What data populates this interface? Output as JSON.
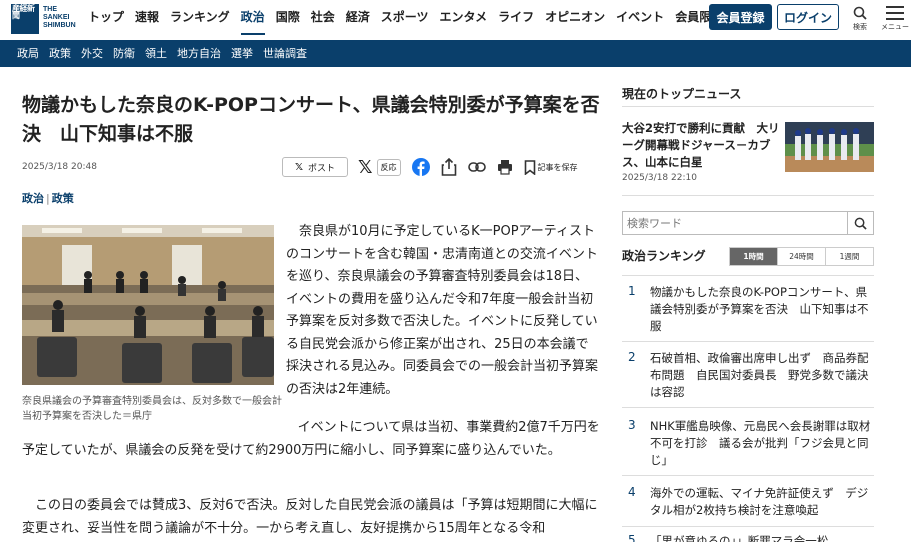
{
  "header": {
    "logo_kanji": "産経新聞",
    "logo_text": "THE\nSANKEI\nSHIMBUN",
    "nav": [
      "トップ",
      "速報",
      "ランキング",
      "政治",
      "国際",
      "社会",
      "経済",
      "スポーツ",
      "エンタメ",
      "ライフ",
      "オピニオン",
      "イベント",
      "会員限定記事"
    ],
    "active_nav": "政治",
    "register_label": "会員登録",
    "login_label": "ログイン",
    "search_label": "検索",
    "menu_label": "メニュー"
  },
  "subnav": [
    "政局",
    "政策",
    "外交",
    "防衛",
    "領土",
    "地方自治",
    "選挙",
    "世論調査"
  ],
  "article": {
    "title": "物議かもした奈良のK-POPコンサート、県議会特別委が予算案を否決　山下知事は不服",
    "date": "2025/3/18 20:48",
    "post_label": "ポスト",
    "hanno_label": "反応",
    "save_label": "記事を保存",
    "tag1": "政治",
    "tag2": "政策",
    "photo_caption": "奈良県議会の予算審査特別委員会は、反対多数で一般会計当初予算案を否決した＝県庁",
    "p1": "奈良県が10月に予定しているK一POPアーティストのコンサートを含む韓国・忠清南道との交流イベントを巡り、奈良県議会の予算審査特別委員会は18日、イベントの費用を盛り込んだ令和7年度一般会計当初予算案を反対多数で否決した。イベントに反発している自民党会派から修正案が出され、25日の本会議で採決される見込み。同委員会での一般会計当初予算案の否決は2年連続。",
    "p2": "イベントについて県は当初、事業費約2億7千万円を予定していたが、県議会の反発を受けて約2900万円に縮小し、同予算案に盛り込んでいた。",
    "p3": "この日の委員会では賛成3、反対6で否決。反対した自民党会派の議員は「予算は短期間に大幅に変更され、妥当性を問う議論が不十分。一から考え直し、友好提携から15周年となる令和"
  },
  "sidebar": {
    "top_news_heading": "現在のトップニュース",
    "top_news_title": "大谷2安打で勝利に貢献　大リーグ開幕戦ドジャース－カブス、山本に白星",
    "top_news_date": "2025/3/18 22:10",
    "search_placeholder": "検索ワード",
    "ranking_heading": "政治ランキング",
    "ranking_tabs": [
      "1時間",
      "24時間",
      "1週間"
    ],
    "ranking": [
      {
        "num": "1",
        "text": "物議かもした奈良のK-POPコンサート、県議会特別委が予算案を否決　山下知事は不服"
      },
      {
        "num": "2",
        "text": "石破首相、政倫審出席申し出ず　商品券配布問題　自民国対委員長　野党多数で議決は容認"
      },
      {
        "num": "3",
        "text": "NHK軍艦島映像、元島民へ会長謝罪は取材不可を打診　議る会が批判「フジ会見と同じ」"
      },
      {
        "num": "4",
        "text": "海外での運転、マイナ免許証使えず　デジタル相が2枚持ち検討を注意喚起"
      },
      {
        "num": "5",
        "text": "「男が意ゆるの」」断罪マラ会一松"
      }
    ]
  },
  "colors": {
    "brand": "#0a3f6b",
    "subnav_bg": "#0a3f6b",
    "facebook": "#1877f2"
  }
}
